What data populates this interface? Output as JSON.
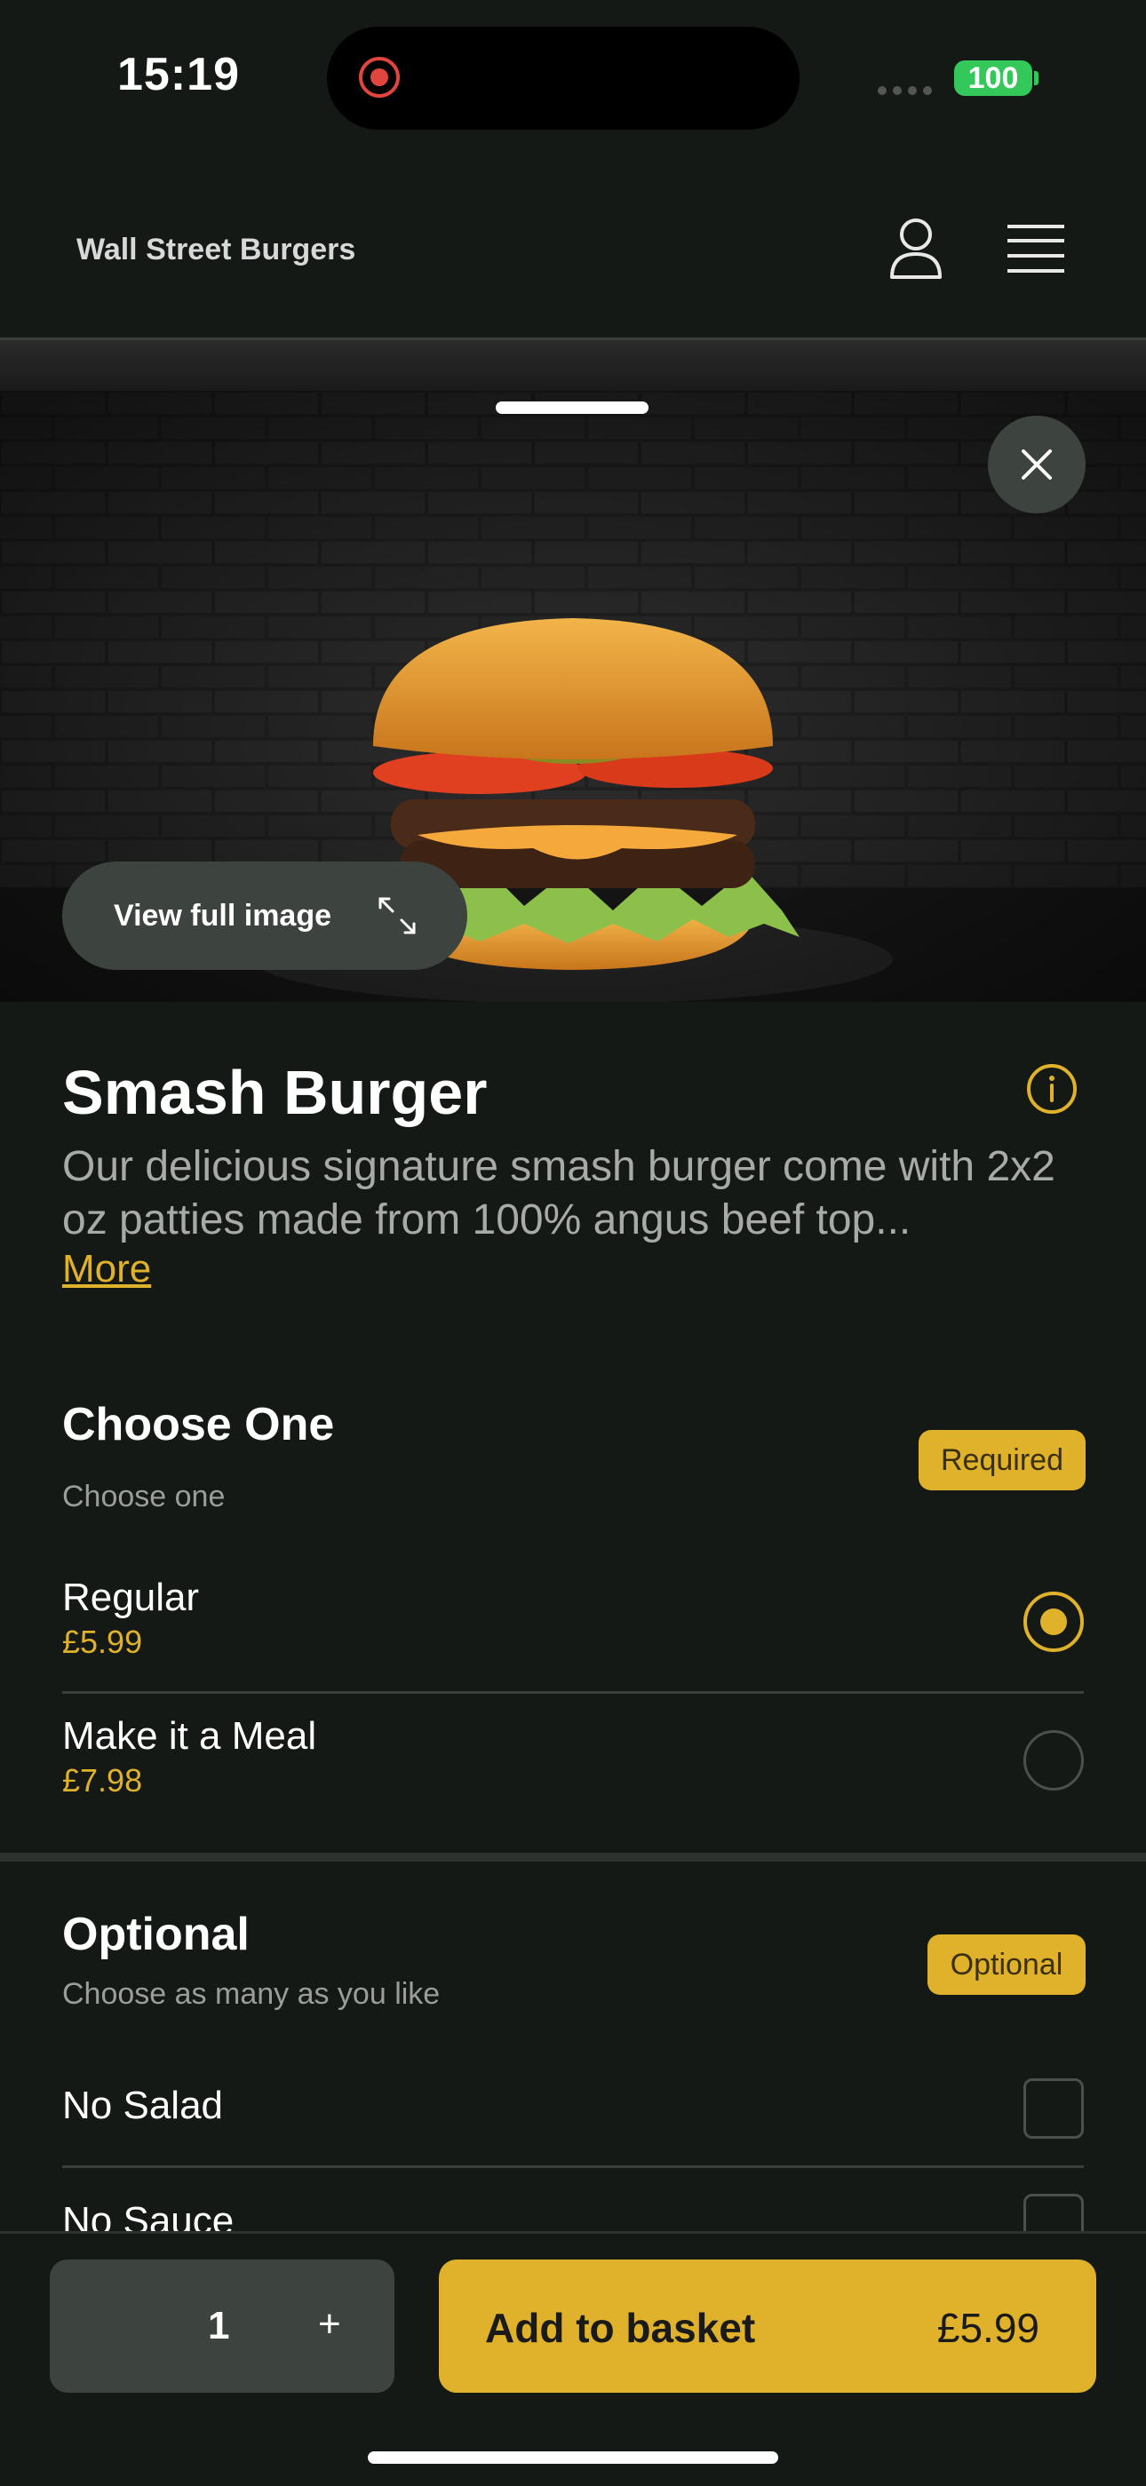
{
  "status_bar": {
    "time": "15:19",
    "battery": "100"
  },
  "header": {
    "brand": "Wall Street Burgers"
  },
  "hero": {
    "view_full_label": "View full image"
  },
  "product": {
    "title": "Smash Burger",
    "description": "Our delicious signature smash burger come with 2x2 oz patties made from 100% angus beef top...",
    "more_label": "More"
  },
  "sections": [
    {
      "title": "Choose One",
      "subtitle": "Choose one",
      "badge": "Required",
      "options": [
        {
          "name": "Regular",
          "price": "£5.99",
          "selected": true
        },
        {
          "name": "Make it a Meal",
          "price": "£7.98",
          "selected": false
        }
      ]
    },
    {
      "title": "Optional",
      "subtitle": "Choose as many as you like",
      "badge": "Optional",
      "options": [
        {
          "name": "No Salad",
          "checked": false
        },
        {
          "name": "No Sauce",
          "checked": false
        }
      ]
    }
  ],
  "basket": {
    "quantity": "1",
    "plus_label": "+",
    "add_label": "Add to basket",
    "price": "£5.99"
  },
  "colors": {
    "accent": "#e0b12a",
    "background": "#141915",
    "surface": "#3d433f"
  }
}
